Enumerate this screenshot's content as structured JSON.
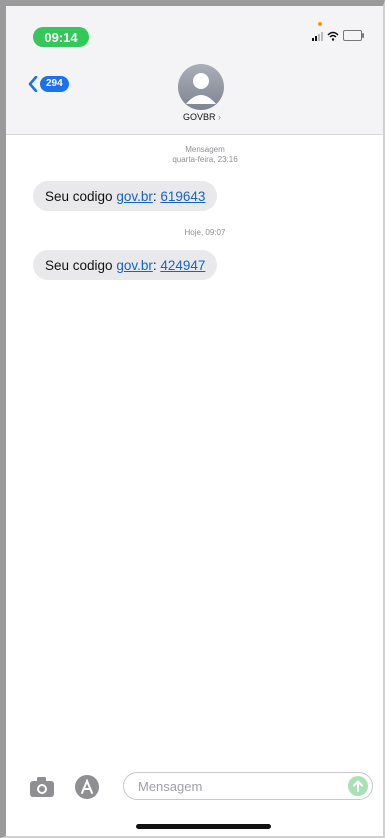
{
  "status_bar": {
    "time": "09:14",
    "icons": [
      "location-dot-icon",
      "signal-icon",
      "wifi-icon",
      "battery-icon"
    ]
  },
  "nav": {
    "back_count": "294",
    "contact_name": "GOVBR",
    "contact_chevron": "›"
  },
  "conversation": {
    "groups": [
      {
        "label": "Mensagem",
        "timestamp": "quarta-feira, 23:16",
        "message": {
          "prefix": "Seu codigo ",
          "link": "gov.br",
          "sep": ": ",
          "code": "619643"
        }
      },
      {
        "timestamp": "Hoje, 09:07",
        "message": {
          "prefix": "Seu codigo ",
          "link": "gov.br",
          "sep": ": ",
          "code": "424947"
        }
      }
    ]
  },
  "composer": {
    "placeholder": "Mensagem",
    "icons": [
      "camera-icon",
      "app-store-icon",
      "send-arrow-icon"
    ]
  },
  "colors": {
    "time_pill": "#34c759",
    "badge": "#1a73e8",
    "bubble": "#e9e9eb",
    "link": "#1565c0"
  }
}
